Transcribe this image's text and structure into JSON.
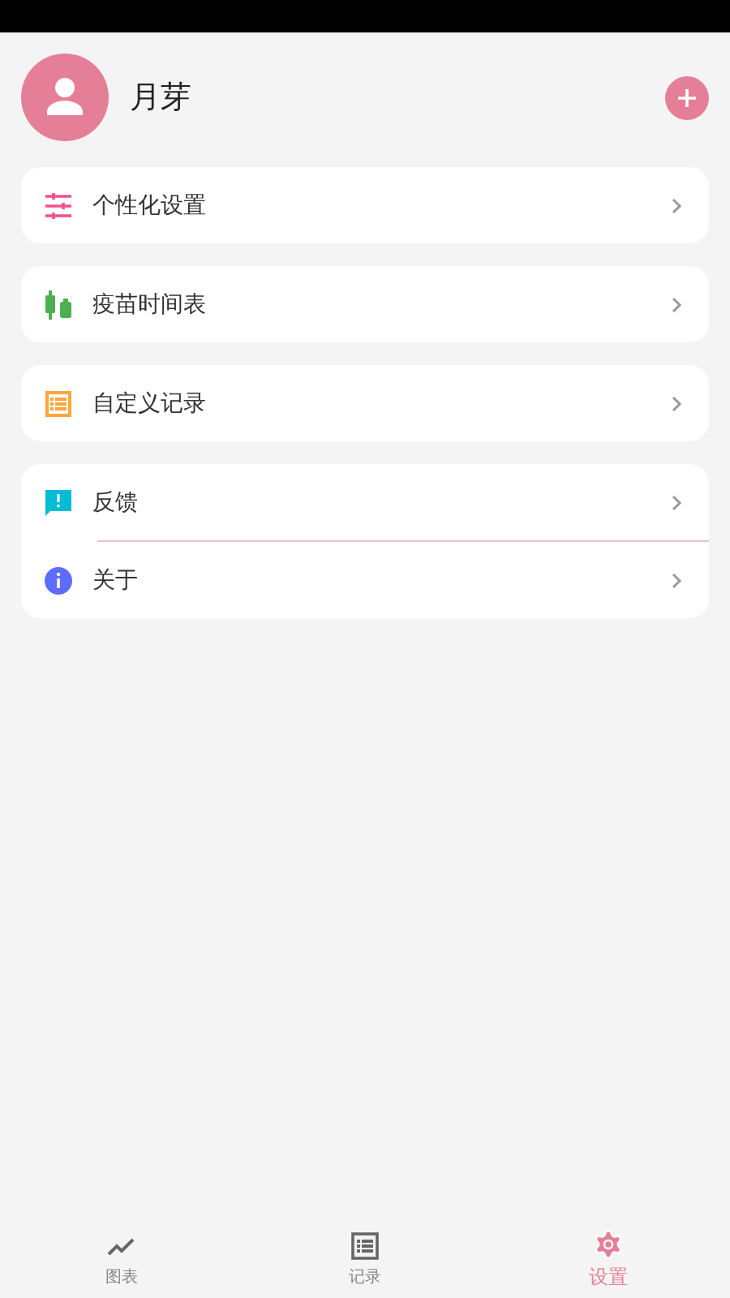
{
  "profile": {
    "name": "月芽"
  },
  "groups": [
    {
      "items": [
        {
          "kind": "personalize",
          "label": "个性化设置"
        }
      ]
    },
    {
      "items": [
        {
          "kind": "vaccine",
          "label": "疫苗时间表"
        }
      ]
    },
    {
      "items": [
        {
          "kind": "records",
          "label": "自定义记录"
        }
      ]
    },
    {
      "items": [
        {
          "kind": "feedback",
          "label": "反馈"
        },
        {
          "kind": "about",
          "label": "关于"
        }
      ]
    }
  ],
  "nav": [
    {
      "kind": "chart",
      "label": "图表",
      "selected": false
    },
    {
      "kind": "records",
      "label": "记录",
      "selected": false
    },
    {
      "kind": "settings",
      "label": "设置",
      "selected": true
    }
  ]
}
